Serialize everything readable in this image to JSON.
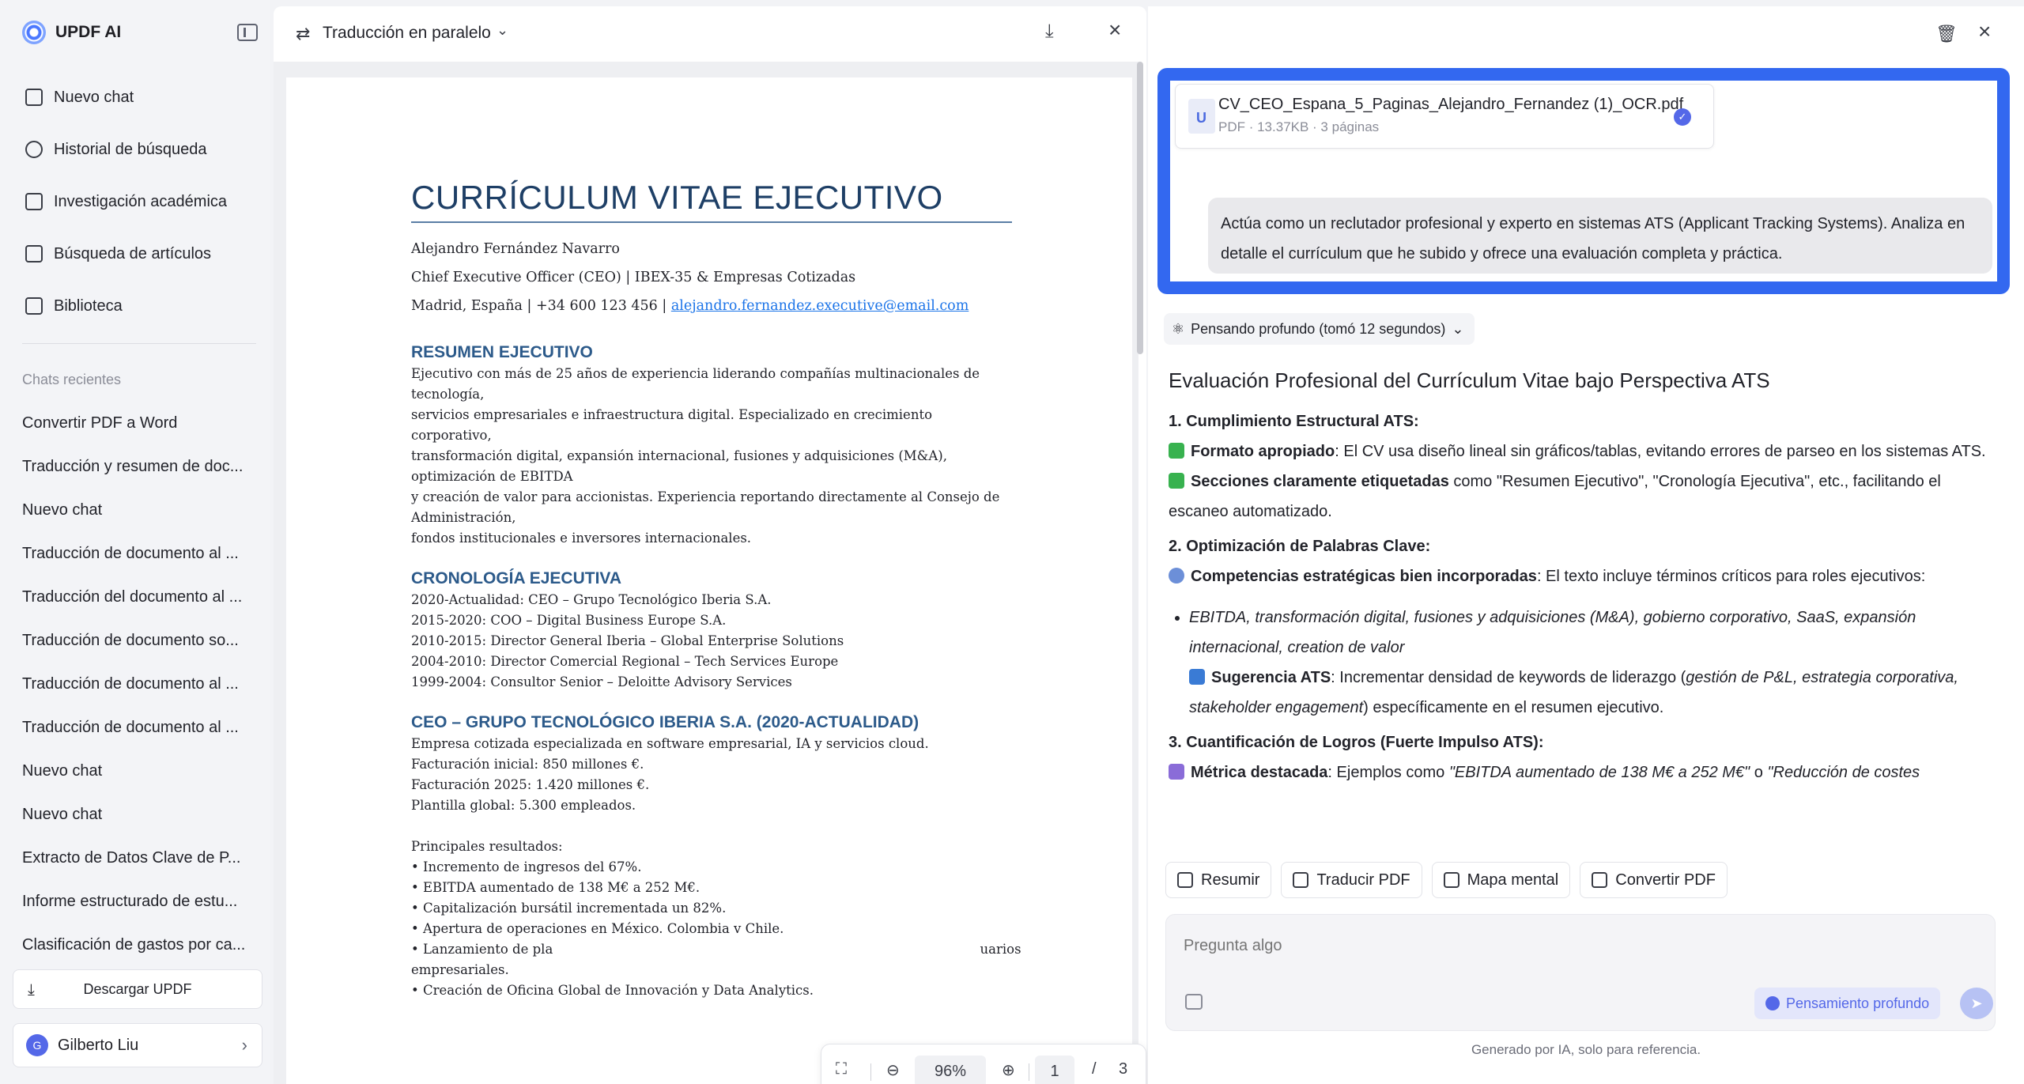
{
  "app": {
    "name": "UPDF AI"
  },
  "sidebar": {
    "nav": [
      {
        "label": "Nuevo chat",
        "icon": "edit-icon"
      },
      {
        "label": "Historial de búsqueda",
        "icon": "search-icon"
      },
      {
        "label": "Investigación académica",
        "icon": "telescope-icon"
      },
      {
        "label": "Búsqueda de artículos",
        "icon": "document-search-icon"
      },
      {
        "label": "Biblioteca",
        "icon": "library-icon"
      }
    ],
    "recent_title": "Chats recientes",
    "recent": [
      "Convertir PDF a Word",
      "Traducción y resumen de doc...",
      "Nuevo chat",
      "Traducción de documento al ...",
      "Traducción del documento al ...",
      "Traducción de documento so...",
      "Traducción de documento al ...",
      "Traducción de documento al ...",
      "Nuevo chat",
      "Nuevo chat",
      "Extracto de Datos Clave de P...",
      "Informe estructurado de estu...",
      "Clasificación de gastos por ca..."
    ],
    "download_label": "Descargar UPDF",
    "user": {
      "initial": "G",
      "name": "Gilberto Liu"
    }
  },
  "doc": {
    "mode": "Traducción en paralelo",
    "cv": {
      "title": "CURRÍCULUM VITAE EJECUTIVO",
      "name": "Alejandro Fernández Navarro",
      "role": "Chief Executive Officer (CEO) | IBEX-35 & Empresas Cotizadas",
      "contact": "Madrid, España | +34 600 123 456 | ",
      "email": "alejandro.fernandez.executive@email.com",
      "h_resumen": "RESUMEN EJECUTIVO",
      "resumen": [
        "Ejecutivo con más de 25 años de experiencia liderando compañías multinacionales de",
        "tecnología,",
        "servicios empresariales e infraestructura digital. Especializado en crecimiento corporativo,",
        "transformación digital, expansión internacional, fusiones y adquisiciones (M&A),",
        "optimización de EBITDA",
        "y creación de valor para accionistas. Experiencia reportando directamente al Consejo de",
        "Administración,",
        "fondos institucionales e inversores internacionales."
      ],
      "h_crono": "CRONOLOGÍA EJECUTIVA",
      "crono": [
        "2020-Actualidad: CEO – Grupo Tecnológico Iberia S.A.",
        "2015-2020: COO – Digital Business Europe S.A.",
        "2010-2015: Director General Iberia – Global Enterprise Solutions",
        "2004-2010: Director Comercial Regional – Tech Services Europe",
        "1999-2004: Consultor Senior – Deloitte Advisory Services"
      ],
      "h_ceo": "CEO – GRUPO TECNOLÓGICO IBERIA S.A. (2020-ACTUALIDAD)",
      "ceo": [
        "Empresa cotizada especializada en software empresarial, IA y servicios cloud.",
        "Facturación inicial: 850 millones €.",
        "Facturación 2025: 1.420 millones €.",
        "Plantilla global: 5.300 empleados."
      ],
      "results_title": "Principales resultados:",
      "results": [
        "• Incremento de ingresos del 67%.",
        "• EBITDA aumentado de 138 M€ a 252 M€.",
        "• Capitalización bursátil incrementada un 82%.",
        "• Apertura de operaciones en México. Colombia v Chile.",
        "• Lanzamiento de pla                                                                                                       uarios",
        "empresariales.",
        "• Creación de Oficina Global de Innovación y Data Analytics."
      ]
    },
    "toolbar": {
      "zoom": "96%",
      "page": "1",
      "separator": "/",
      "total": "3"
    }
  },
  "chat": {
    "file": {
      "name": "CV_CEO_Espana_5_Paginas_Alejandro_Fernandez (1)_OCR.pdf",
      "meta": "PDF · 13.37KB · 3 páginas"
    },
    "user_message": "Actúa como un reclutador profesional y experto en sistemas ATS (Applicant Tracking Systems). Analiza en detalle el currículum que he subido y ofrece una evaluación completa y práctica.",
    "thinking": "Pensando profundo (tomó 12 segundos)",
    "answer": {
      "title": "Evaluación Profesional del Currículum Vitae bajo Perspectiva ATS",
      "s1": "1. Cumplimiento Estructural ATS:",
      "s1a_b": "Formato apropiado",
      "s1a": ": El CV usa diseño lineal sin gráficos/tablas, evitando errores de parseo en los sistemas ATS.",
      "s1b_b": "Secciones claramente etiquetadas",
      "s1b": " como \"Resumen Ejecutivo\", \"Cronología Ejecutiva\", etc., facilitando el escaneo automatizado.",
      "s2": "2. Optimización de Palabras Clave:",
      "s2a_b": "Competencias estratégicas bien incorporadas",
      "s2a": ": El texto incluye términos críticos para roles ejecutivos:",
      "s2_list": "EBITDA, transformación digital, fusiones y adquisiciones (M&A), gobierno corporativo, SaaS, expansión internacional, creation de valor",
      "s2b_b": "Sugerencia ATS",
      "s2b_pre": ": Incrementar densidad de keywords de liderazgo (",
      "s2b_it": "gestión de P&L, estrategia corporativa, stakeholder engagement",
      "s2b_post": ") específicamente en el resumen ejecutivo.",
      "s3": "3. Cuantificación de Logros (Fuerte Impulso ATS):",
      "s3a_b": "Métrica destacada",
      "s3a_pre": ": Ejemplos como ",
      "s3a_it": "\"EBITDA aumentado de 138 M€ a 252 M€\"",
      "s3a_mid": " o ",
      "s3a_it2": "\"Reducción de costes"
    },
    "actions": [
      "Resumir",
      "Traducir PDF",
      "Mapa mental",
      "Convertir PDF"
    ],
    "input_placeholder": "Pregunta algo",
    "deep_label": "Pensamiento profundo",
    "footer": "Generado por IA, solo para referencia."
  },
  "colors": {
    "accent": "#3368f0",
    "heading": "#2c5a8a",
    "link": "#1a73e8"
  }
}
